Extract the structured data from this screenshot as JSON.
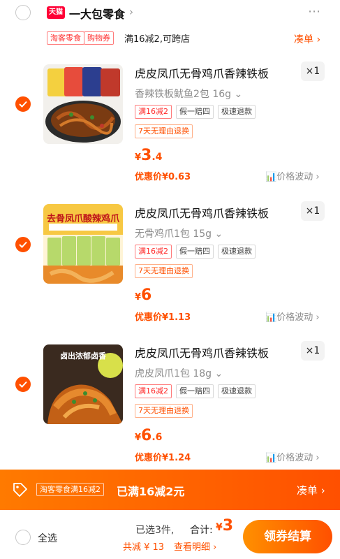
{
  "store": {
    "logo_text": "天猫",
    "name": "一大包零食",
    "chevron": "›",
    "more": "⋯"
  },
  "promo": {
    "tag1": "淘客零食",
    "tag2": "购物券",
    "text": "满16减2,可跨店",
    "link": "凑单 ›"
  },
  "items": [
    {
      "title": "虎皮凤爪无骨鸡爪香辣铁板",
      "qty": "×1",
      "variant": "香辣铁板鱿鱼2包 16g",
      "tags": [
        "满16减2",
        "假一赔四",
        "极速退款"
      ],
      "tag2": "7天无理由退换",
      "price_currency": "¥",
      "price_int": "3",
      "price_dec": ".4",
      "discount": "优惠价¥0.63",
      "trend": "价格波动 ›",
      "checked": true
    },
    {
      "title": "虎皮凤爪无骨鸡爪香辣铁板",
      "qty": "×1",
      "variant": "无骨鸡爪1包 15g",
      "tags": [
        "满16减2",
        "假一赔四",
        "极速退款"
      ],
      "tag2": "7天无理由退换",
      "price_currency": "¥",
      "price_int": "6",
      "price_dec": "",
      "discount": "优惠价¥1.13",
      "trend": "价格波动 ›",
      "checked": true,
      "thumb_text": "去骨凤爪酸辣鸡爪"
    },
    {
      "title": "虎皮凤爪无骨鸡爪香辣铁板",
      "qty": "×1",
      "variant": "虎皮凤爪1包 18g",
      "tags": [
        "满16减2",
        "假一赔四",
        "极速退款"
      ],
      "tag2": "7天无理由退换",
      "price_currency": "¥",
      "price_int": "6",
      "price_dec": ".6",
      "discount": "优惠价¥1.24",
      "trend": "价格波动 ›",
      "checked": true,
      "thumb_text": "卤出浓郁卤香"
    }
  ],
  "orange_bar": {
    "tag": "淘客零食满16减2",
    "text": "已满16减2元",
    "link": "凑单 ›"
  },
  "bottom": {
    "select_all": "全选",
    "selected_count": "已选3件,",
    "total_label": "合计:",
    "total_currency": "¥",
    "total_int": "3",
    "saving": "共减 ¥ 13",
    "detail_link": "查看明细 ›",
    "checkout": "领券结算"
  },
  "colors": {
    "accent": "#ff5000",
    "tmall_red": "#ff0036"
  }
}
